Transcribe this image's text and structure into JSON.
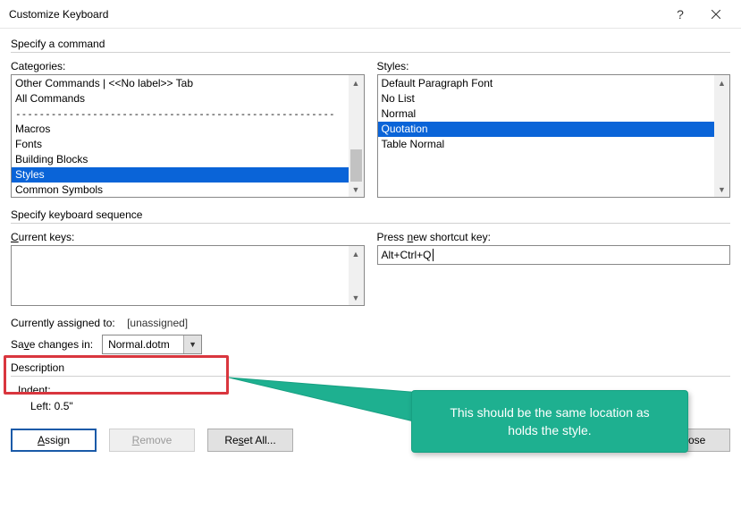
{
  "title": "Customize Keyboard",
  "section1": "Specify a command",
  "categories_label_pre": "Cate",
  "categories_label_u": "g",
  "categories_label_post": "ories:",
  "styles_label": "Styles:",
  "categories": {
    "items": [
      "Other Commands | <<No label>> Tab",
      "All Commands",
      "------------------------------------------------------",
      "Macros",
      "Fonts",
      "Building Blocks",
      "Styles",
      "Common Symbols"
    ],
    "selected_index": 6
  },
  "styles": {
    "items": [
      "Default Paragraph Font",
      "No List",
      "Normal",
      "Quotation",
      "Table Normal"
    ],
    "selected_index": 3
  },
  "section2": "Specify keyboard sequence",
  "current_keys_label_u": "C",
  "current_keys_label_post": "urrent keys:",
  "press_new_pre": "Press ",
  "press_new_u": "n",
  "press_new_post": "ew shortcut key:",
  "new_shortcut_value": "Alt+Ctrl+Q",
  "currently_assigned_label": "Currently assigned to:",
  "currently_assigned_value": "[unassigned]",
  "save_changes_pre": "Sa",
  "save_changes_u": "v",
  "save_changes_post": "e changes in:",
  "save_changes_value": "Normal.dotm",
  "description_label": "Description",
  "desc_line1": "Indent:",
  "desc_line2": "Left:  0.5\"",
  "buttons": {
    "assign_u": "A",
    "assign_post": "ssign",
    "remove_u": "R",
    "remove_post": "emove",
    "reset_pre": "Re",
    "reset_u": "s",
    "reset_post": "et All...",
    "close": "Close"
  },
  "callout_line1": "This should be the same location as",
  "callout_line2": "holds the style."
}
